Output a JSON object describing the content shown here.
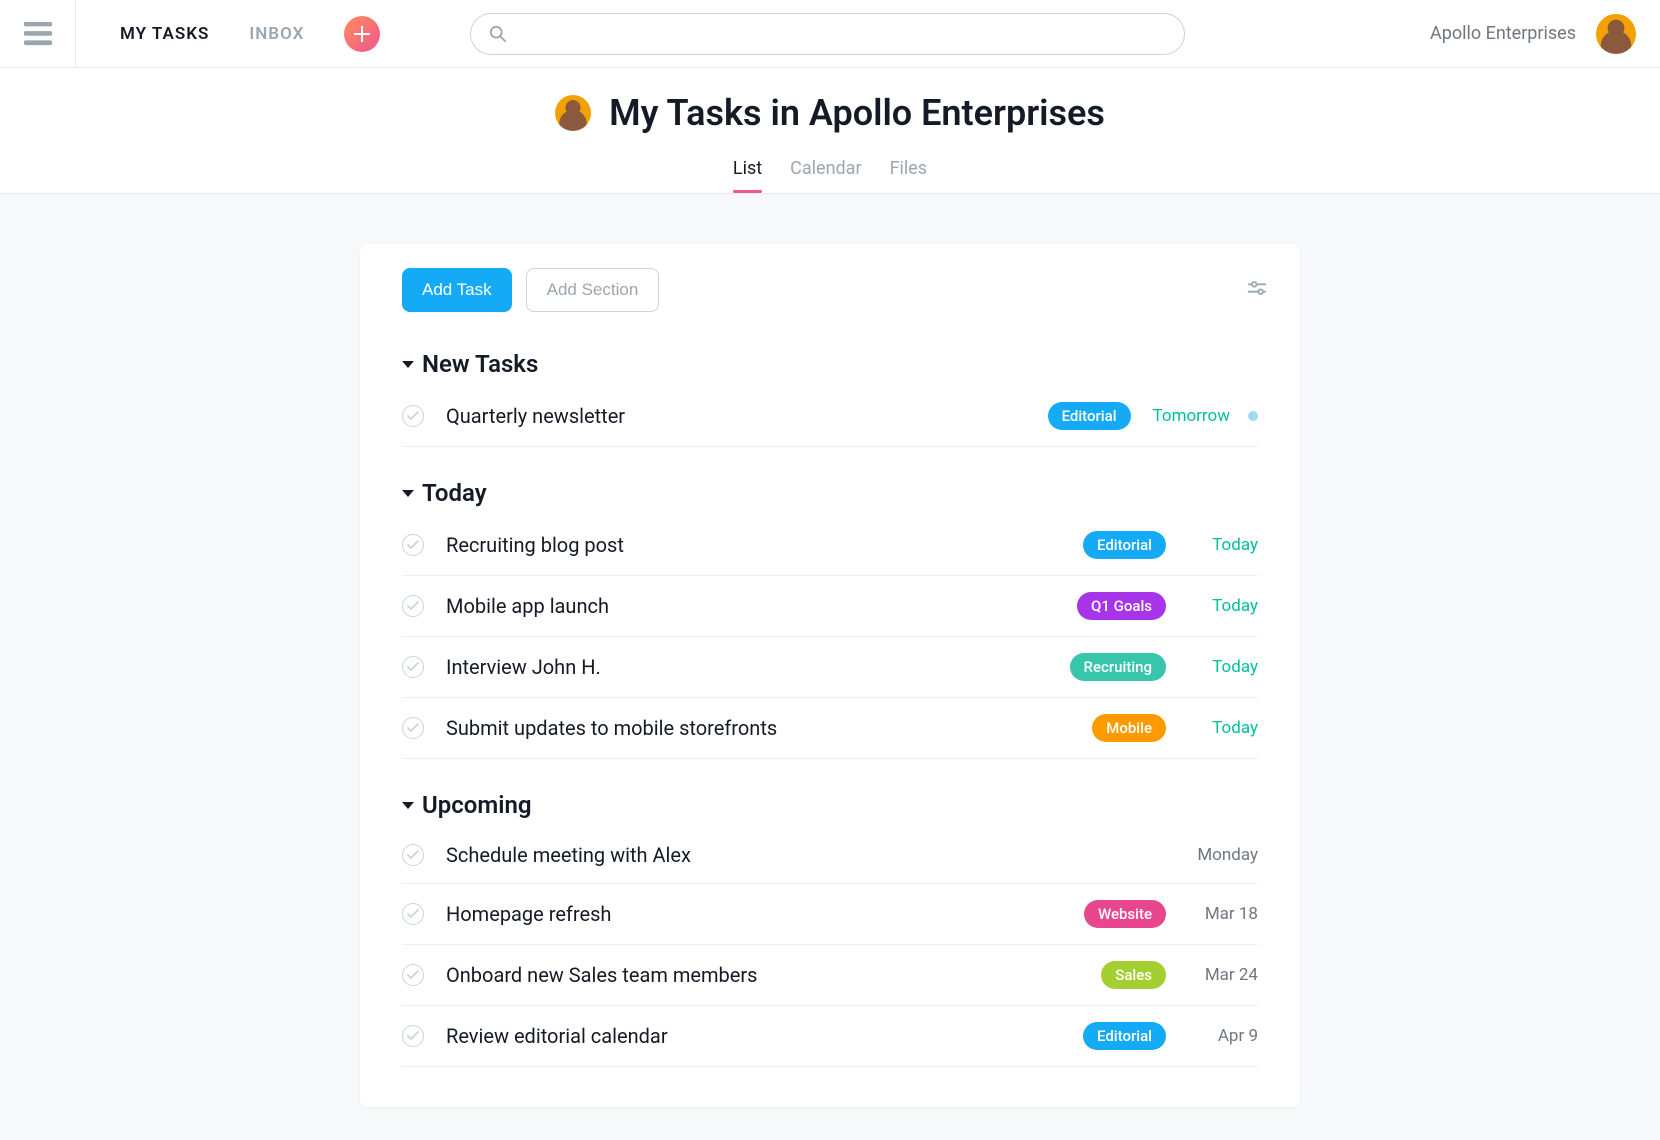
{
  "topbar": {
    "nav": {
      "my_tasks": "MY TASKS",
      "inbox": "INBOX"
    },
    "workspace": "Apollo Enterprises",
    "search_placeholder": ""
  },
  "header": {
    "title": "My Tasks in Apollo Enterprises",
    "views": {
      "list": "List",
      "calendar": "Calendar",
      "files": "Files"
    }
  },
  "toolbar": {
    "add_task": "Add Task",
    "add_section": "Add Section"
  },
  "tag_colors": {
    "Editorial": "#14aaf5",
    "Q1 Goals": "#a734e9",
    "Recruiting": "#37c5ab",
    "Mobile": "#fd9a00",
    "Website": "#e8468e",
    "Sales": "#a4cf30"
  },
  "sections": [
    {
      "title": "New Tasks",
      "tasks": [
        {
          "title": "Quarterly newsletter",
          "tag": "Editorial",
          "due": "Tomorrow",
          "due_style": "green",
          "dot": true
        }
      ]
    },
    {
      "title": "Today",
      "tasks": [
        {
          "title": "Recruiting blog post",
          "tag": "Editorial",
          "due": "Today",
          "due_style": "green"
        },
        {
          "title": "Mobile app launch",
          "tag": "Q1 Goals",
          "due": "Today",
          "due_style": "green"
        },
        {
          "title": "Interview John H.",
          "tag": "Recruiting",
          "due": "Today",
          "due_style": "green"
        },
        {
          "title": "Submit updates to mobile storefronts",
          "tag": "Mobile",
          "due": "Today",
          "due_style": "green"
        }
      ]
    },
    {
      "title": "Upcoming",
      "tasks": [
        {
          "title": "Schedule meeting with Alex",
          "tag": null,
          "due": "Monday",
          "due_style": "gray"
        },
        {
          "title": "Homepage refresh",
          "tag": "Website",
          "due": "Mar 18",
          "due_style": "gray"
        },
        {
          "title": "Onboard new Sales team members",
          "tag": "Sales",
          "due": "Mar 24",
          "due_style": "gray"
        },
        {
          "title": "Review editorial calendar",
          "tag": "Editorial",
          "due": "Apr 9",
          "due_style": "gray"
        }
      ]
    }
  ]
}
